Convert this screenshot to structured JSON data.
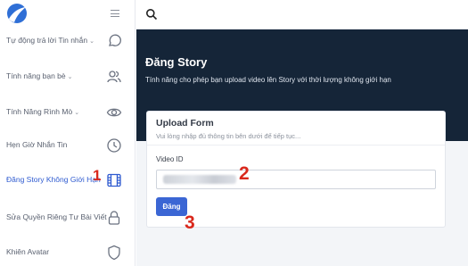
{
  "sidebar": {
    "menu_icon": "hamburger-icon",
    "logo_icon": "app-logo-icon",
    "items": [
      {
        "label": "Tự động trả lời Tin nhắn",
        "has_chevron": true,
        "icon": "chat-bubble-icon"
      },
      {
        "label": "Tính năng bạn bè",
        "has_chevron": true,
        "icon": "users-icon"
      },
      {
        "label": "Tính Năng Rình Mò",
        "has_chevron": true,
        "icon": "eye-icon"
      },
      {
        "label": "Hẹn Giờ Nhắn Tin",
        "has_chevron": false,
        "icon": "clock-icon"
      },
      {
        "label": "Đăng Story Không Giới Hạn",
        "has_chevron": false,
        "icon": "film-icon",
        "active": true
      },
      {
        "label": "Sửa Quyền Riêng Tư Bài Viết",
        "has_chevron": false,
        "icon": "lock-icon"
      },
      {
        "label": "Khiên Avatar",
        "has_chevron": false,
        "icon": "shield-icon"
      }
    ],
    "chevron_glyph": "⌄"
  },
  "topbar": {
    "search_icon": "search-icon"
  },
  "hero": {
    "title": "Đăng Story",
    "subtitle": "Tính năng cho phép bạn upload video lên Story với thời lượng không giới hạn"
  },
  "form": {
    "title": "Upload Form",
    "subtitle": "Vui lòng nhập đủ thông tin bên dưới để tiếp tục...",
    "video_id_label": "Video ID",
    "video_id_value": "",
    "submit_label": "Đăng"
  },
  "annotations": {
    "marker_1": "1",
    "marker_2": "2",
    "marker_3": "3"
  },
  "colors": {
    "accent": "#3b66d4",
    "hero_bg": "#152538",
    "marker": "#d9281c",
    "active_nav": "#2f5bd0"
  }
}
